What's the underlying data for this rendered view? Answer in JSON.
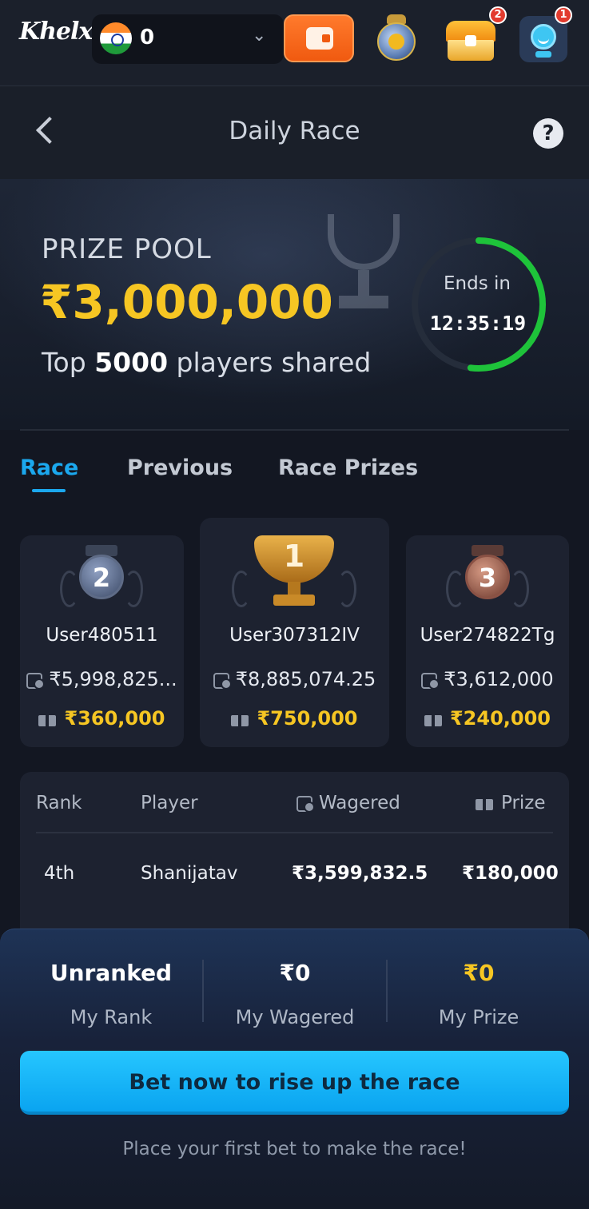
{
  "header": {
    "logo": "Khelx",
    "balance": "0",
    "chest_badge": "2",
    "support_badge": "1"
  },
  "titlebar": {
    "title": "Daily Race",
    "help": "?"
  },
  "hero": {
    "pool_label": "PRIZE POOL",
    "pool_amount": "₹3,000,000",
    "sub_prefix": "Top ",
    "sub_count": "5000",
    "sub_suffix": " players shared",
    "ends_label": "Ends in",
    "ends_time": "12:35:19",
    "countdown_fraction_remaining": 0.52,
    "ring_color": "#1ec33a"
  },
  "tabs": [
    {
      "label": "Race",
      "active": true
    },
    {
      "label": "Previous",
      "active": false
    },
    {
      "label": "Race Prizes",
      "active": false
    }
  ],
  "podium": {
    "second": {
      "rank": "2",
      "name": "User480511",
      "wagered": "₹5,998,825...",
      "prize": "₹360,000"
    },
    "first": {
      "rank": "1",
      "name": "User307312IV",
      "wagered": "₹8,885,074.25",
      "prize": "₹750,000"
    },
    "third": {
      "rank": "3",
      "name": "User274822Tg",
      "wagered": "₹3,612,000",
      "prize": "₹240,000"
    }
  },
  "table": {
    "headers": {
      "rank": "Rank",
      "player": "Player",
      "wagered": "Wagered",
      "prize": "Prize"
    },
    "rows": [
      {
        "rank": "4th",
        "player": "Shanijatav",
        "wagered": "₹3,599,832.5",
        "prize": "₹180,000"
      }
    ]
  },
  "my_stats": {
    "rank_value": "Unranked",
    "rank_label": "My Rank",
    "wagered_value": "₹0",
    "wagered_label": "My Wagered",
    "prize_value": "₹0",
    "prize_label": "My Prize"
  },
  "cta": {
    "label": "Bet now to rise up the race"
  },
  "hint": "Place your first bet to make the race!",
  "colors": {
    "accent": "#1ba8ee",
    "gold": "#f6c623",
    "background": "#131722"
  }
}
